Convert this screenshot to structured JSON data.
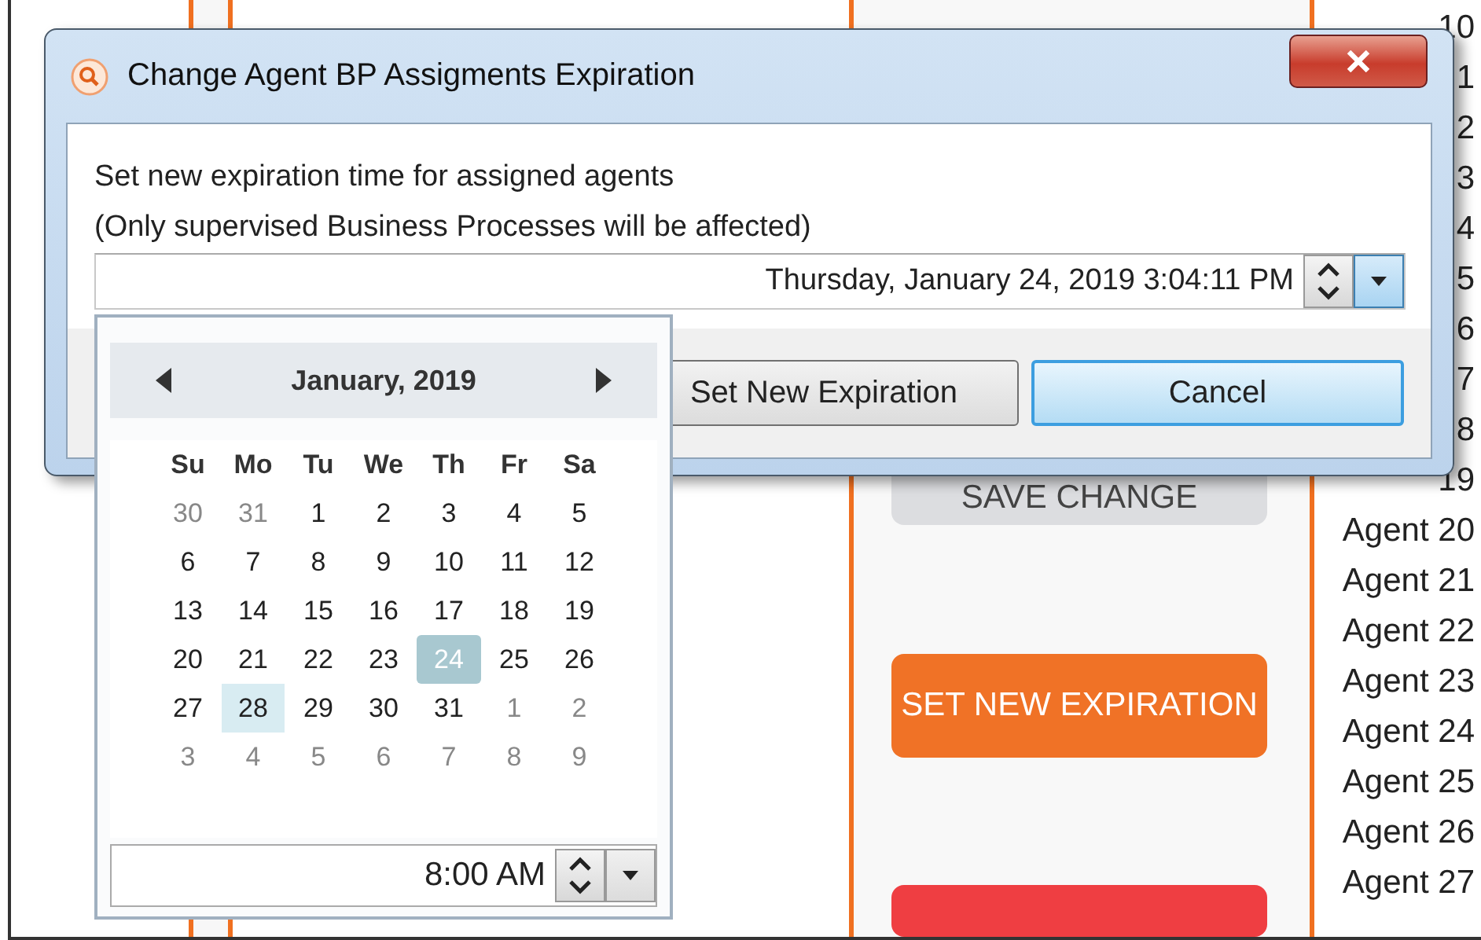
{
  "background": {
    "panel_buttons": [
      {
        "kind": "neutral",
        "label": "SAVE CHANGE"
      },
      {
        "kind": "primary",
        "label": "SET NEW EXPIRATION"
      },
      {
        "kind": "danger"
      }
    ],
    "agents": [
      "10",
      "1",
      "2",
      "3",
      "4",
      "5",
      "6",
      "7",
      "8",
      "19",
      "Agent 20",
      "Agent 21",
      "Agent 22",
      "Agent 23",
      "Agent 24",
      "Agent 25",
      "Agent 26",
      "Agent 27"
    ]
  },
  "dialog": {
    "title": "Change Agent BP Assigments Expiration",
    "message": [
      "Set new expiration time for assigned agents",
      "(Only supervised Business Processes will be affected)"
    ],
    "date_field": {
      "value": "Thursday, January 24, 2019 3:04:11 PM",
      "dropdown_open": true
    },
    "buttons": [
      {
        "label": "Set New Expiration",
        "default": false
      },
      {
        "label": "Cancel",
        "default": true
      }
    ]
  },
  "calendar": {
    "month": "January, 2019",
    "weekdays": [
      "Su",
      "Mo",
      "Tu",
      "We",
      "Th",
      "Fr",
      "Sa"
    ],
    "weeks": [
      [
        {
          "text": "30",
          "other_month": true,
          "selected": false,
          "highlighted": false
        },
        {
          "text": "31",
          "other_month": true,
          "selected": false,
          "highlighted": false
        },
        {
          "text": "1",
          "other_month": false,
          "selected": false,
          "highlighted": false
        },
        {
          "text": "2",
          "other_month": false,
          "selected": false,
          "highlighted": false
        },
        {
          "text": "3",
          "other_month": false,
          "selected": false,
          "highlighted": false
        },
        {
          "text": "4",
          "other_month": false,
          "selected": false,
          "highlighted": false
        },
        {
          "text": "5",
          "other_month": false,
          "selected": false,
          "highlighted": false
        }
      ],
      [
        {
          "text": "6",
          "other_month": false,
          "selected": false,
          "highlighted": false
        },
        {
          "text": "7",
          "other_month": false,
          "selected": false,
          "highlighted": false
        },
        {
          "text": "8",
          "other_month": false,
          "selected": false,
          "highlighted": false
        },
        {
          "text": "9",
          "other_month": false,
          "selected": false,
          "highlighted": false
        },
        {
          "text": "10",
          "other_month": false,
          "selected": false,
          "highlighted": false
        },
        {
          "text": "11",
          "other_month": false,
          "selected": false,
          "highlighted": false
        },
        {
          "text": "12",
          "other_month": false,
          "selected": false,
          "highlighted": false
        }
      ],
      [
        {
          "text": "13",
          "other_month": false,
          "selected": false,
          "highlighted": false
        },
        {
          "text": "14",
          "other_month": false,
          "selected": false,
          "highlighted": false
        },
        {
          "text": "15",
          "other_month": false,
          "selected": false,
          "highlighted": false
        },
        {
          "text": "16",
          "other_month": false,
          "selected": false,
          "highlighted": false
        },
        {
          "text": "17",
          "other_month": false,
          "selected": false,
          "highlighted": false
        },
        {
          "text": "18",
          "other_month": false,
          "selected": false,
          "highlighted": false
        },
        {
          "text": "19",
          "other_month": false,
          "selected": false,
          "highlighted": false
        }
      ],
      [
        {
          "text": "20",
          "other_month": false,
          "selected": false,
          "highlighted": false
        },
        {
          "text": "21",
          "other_month": false,
          "selected": false,
          "highlighted": false
        },
        {
          "text": "22",
          "other_month": false,
          "selected": false,
          "highlighted": false
        },
        {
          "text": "23",
          "other_month": false,
          "selected": false,
          "highlighted": false
        },
        {
          "text": "24",
          "other_month": false,
          "selected": true,
          "highlighted": false
        },
        {
          "text": "25",
          "other_month": false,
          "selected": false,
          "highlighted": false
        },
        {
          "text": "26",
          "other_month": false,
          "selected": false,
          "highlighted": false
        }
      ],
      [
        {
          "text": "27",
          "other_month": false,
          "selected": false,
          "highlighted": false
        },
        {
          "text": "28",
          "other_month": false,
          "selected": false,
          "highlighted": true
        },
        {
          "text": "29",
          "other_month": false,
          "selected": false,
          "highlighted": false
        },
        {
          "text": "30",
          "other_month": false,
          "selected": false,
          "highlighted": false
        },
        {
          "text": "31",
          "other_month": false,
          "selected": false,
          "highlighted": false
        },
        {
          "text": "1",
          "other_month": true,
          "selected": false,
          "highlighted": false
        },
        {
          "text": "2",
          "other_month": true,
          "selected": false,
          "highlighted": false
        }
      ],
      [
        {
          "text": "3",
          "other_month": true,
          "selected": false,
          "highlighted": false
        },
        {
          "text": "4",
          "other_month": true,
          "selected": false,
          "highlighted": false
        },
        {
          "text": "5",
          "other_month": true,
          "selected": false,
          "highlighted": false
        },
        {
          "text": "6",
          "other_month": true,
          "selected": false,
          "highlighted": false
        },
        {
          "text": "7",
          "other_month": true,
          "selected": false,
          "highlighted": false
        },
        {
          "text": "8",
          "other_month": true,
          "selected": false,
          "highlighted": false
        },
        {
          "text": "9",
          "other_month": true,
          "selected": false,
          "highlighted": false
        }
      ]
    ],
    "time_field": {
      "value": "8:00 AM"
    }
  }
}
